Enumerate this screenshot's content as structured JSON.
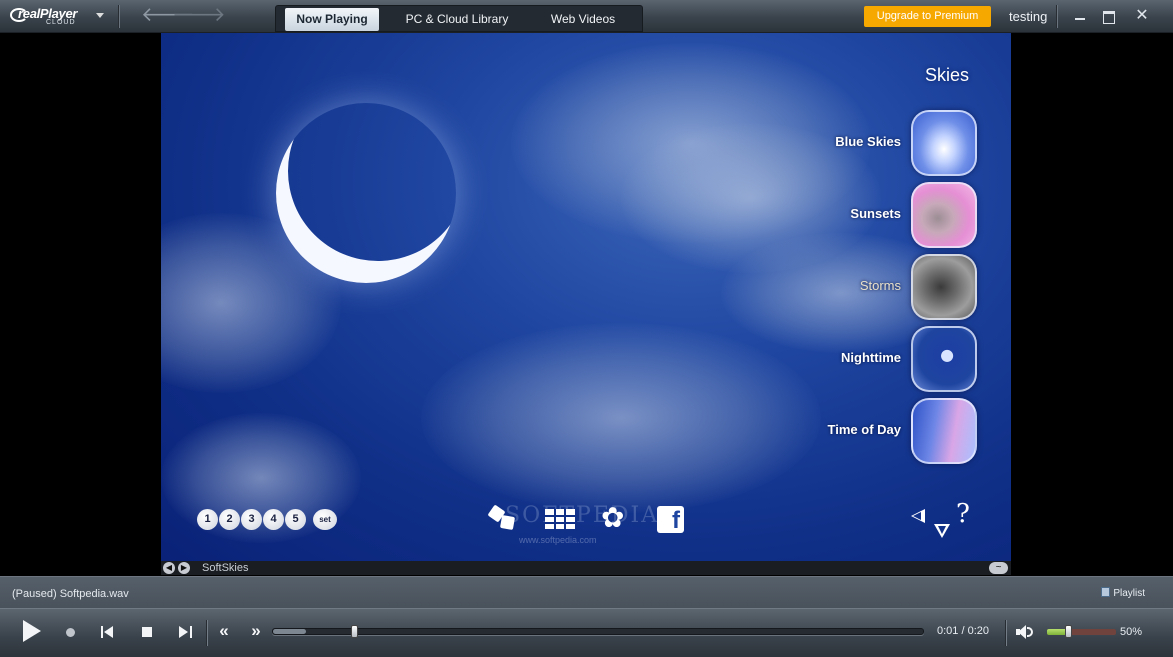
{
  "app": {
    "logo_text": "realPlayer",
    "logo_sub": "CLOUD",
    "username": "testing",
    "upgrade_label": "Upgrade to Premium",
    "accent_color": "#f7a800"
  },
  "tabs": [
    {
      "label": "Now Playing",
      "active": true
    },
    {
      "label": "PC & Cloud Library",
      "active": false
    },
    {
      "label": "Web Videos",
      "active": false
    }
  ],
  "skies_panel": {
    "title": "Skies",
    "items": [
      {
        "label": "Blue Skies",
        "thumb": "blue-skies"
      },
      {
        "label": "Sunsets",
        "thumb": "sunsets"
      },
      {
        "label": "Storms",
        "thumb": "storms",
        "dimmed": true
      },
      {
        "label": "Nighttime",
        "thumb": "nighttime"
      },
      {
        "label": "Time of Day",
        "thumb": "time-of-day"
      }
    ]
  },
  "presets": [
    "1",
    "2",
    "3",
    "4",
    "5"
  ],
  "preset_set_label": "set",
  "watermark": {
    "text": "SOFTPEDIA",
    "url": "www.softpedia.com"
  },
  "visualization": {
    "name": "SoftSkies"
  },
  "status": {
    "text": "(Paused) Softpedia.wav",
    "playlist_label": "Playlist"
  },
  "playback": {
    "time_readout": "0:01 / 0:20",
    "position_seconds": 1,
    "duration_seconds": 20,
    "volume_label": "50%",
    "volume_fraction": 0.3
  },
  "icons": {
    "rewind": "«",
    "fast_forward": "»",
    "back": "🡐",
    "forward": "🡒",
    "close": "✕",
    "help": "?"
  }
}
